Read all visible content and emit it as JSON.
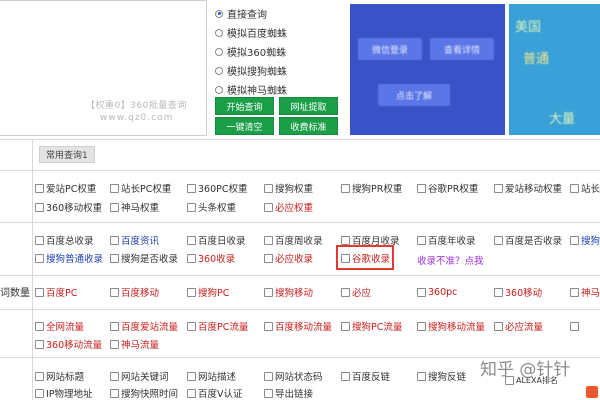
{
  "watermark": {
    "line1": "【权重0】360批量查询",
    "line2": "www.qz0.com"
  },
  "radios": [
    {
      "label": "直接查询",
      "checked": true
    },
    {
      "label": "模拟百度蜘蛛",
      "checked": false
    },
    {
      "label": "模拟360蜘蛛",
      "checked": false
    },
    {
      "label": "模拟搜狗蜘蛛",
      "checked": false
    },
    {
      "label": "模拟神马蜘蛛",
      "checked": false
    }
  ],
  "buttons": {
    "start": "开始查询",
    "extract": "网址提取",
    "clear": "一键清空",
    "pricing": "收费标准"
  },
  "banner1": {
    "btn1": "微信登录",
    "btn2": "查看详情",
    "btn3": "点击了解"
  },
  "banner2": {
    "line1": "美国",
    "line2": "普通",
    "line3": "大量"
  },
  "common_tab": "常用查询1",
  "row_label": "词数量",
  "rows": {
    "r1": [
      "爱站PC权重",
      "站长PC权重",
      "360PC权重",
      "搜狗权重",
      "搜狗PR权重",
      "谷歌PR权重",
      "爱站移动权重",
      "站长"
    ],
    "r2": [
      "360移动权重",
      "神马权重",
      "头条权重",
      "必应权重"
    ],
    "r3": [
      "百度总收录",
      "百度资讯",
      "百度日收录",
      "百度周收录",
      "百度月收录",
      "百度年收录",
      "百度是否收录",
      "搜狗"
    ],
    "r4": [
      "搜狗普通收录",
      "搜狗是否收录",
      "360收录",
      "必应收录",
      "谷歌收录"
    ],
    "r5": [
      "百度PC",
      "百度移动",
      "搜狗PC",
      "搜狗移动",
      "必应",
      "360pc",
      "360移动",
      "神马"
    ],
    "r6": [
      "全网流量",
      "百度爱站流量",
      "百度PC流量",
      "百度移动流量",
      "搜狗PC流量",
      "搜狗移动流量",
      "必应流量",
      ""
    ],
    "r7": [
      "360移动流量",
      "神马流量"
    ],
    "r8": [
      "网站标题",
      "网站关键词",
      "网站描述",
      "网站状态码",
      "百度反链",
      "搜狗反链",
      "ALEXA排名"
    ],
    "r9": [
      "IP物理地址",
      "搜狗快照时间",
      "百度V认证",
      "导出链接"
    ]
  },
  "link_purple": "收录不准？点我",
  "zhihu_watermark": "知乎 @针针",
  "colors": {
    "red": "#c8201d",
    "blue": "#1d3fb0",
    "green": "#1a9e47",
    "purple": "#9b30d9",
    "highlight": "#e23a2e"
  }
}
